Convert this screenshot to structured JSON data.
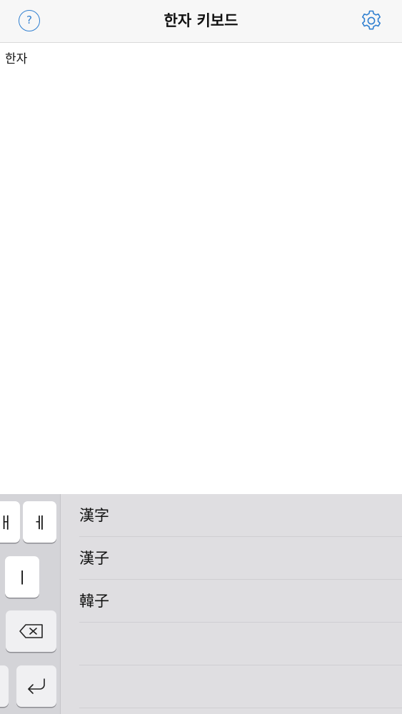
{
  "navbar": {
    "help_label": "?",
    "title": "한자 키보드"
  },
  "editor": {
    "text": "한자"
  },
  "keyboard": {
    "keys": {
      "row1_left": "ㅐ",
      "row1_right": "ㅔ",
      "row2": "ㅣ"
    },
    "candidates": [
      "漢字",
      "漢子",
      "韓子",
      ""
    ]
  },
  "icons": {
    "help": "question-circle-icon",
    "settings": "gear-icon",
    "backspace": "backspace-icon",
    "return": "return-icon"
  },
  "colors": {
    "accent": "#2f7fd0",
    "keyboard_bg": "#d4d4d8",
    "candidate_bg": "#dfdee1"
  }
}
